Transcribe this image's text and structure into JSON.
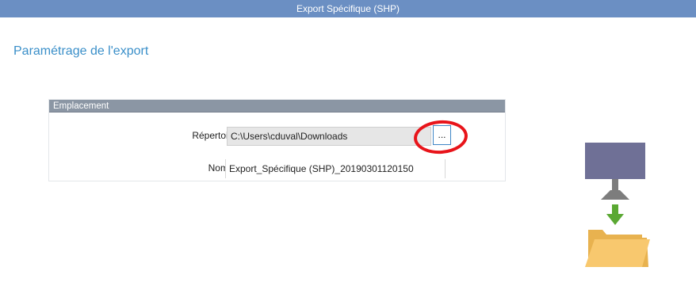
{
  "window": {
    "title": "Export Spécifique (SHP)"
  },
  "page": {
    "title": "Paramétrage de l'export"
  },
  "location_group": {
    "header": "Emplacement",
    "export_dir_label": "Répertoire d'export",
    "export_dir_value": "C:\\Users\\cduval\\Downloads",
    "browse_label": "...",
    "filename_label": "Nom du Fichier",
    "filename_value": "Export_Spécifique (SHP)_20190301120150"
  },
  "colors": {
    "titlebar": "#6b8fc3",
    "page_title": "#3a8fc9",
    "group_header": "#8b96a4",
    "annotation": "#e8141a",
    "monitor": "#6f7096",
    "arrow": "#5aa832",
    "folder": "#f6c46c"
  },
  "icons": [
    "monitor-icon",
    "download-arrow-icon",
    "folder-icon"
  ]
}
